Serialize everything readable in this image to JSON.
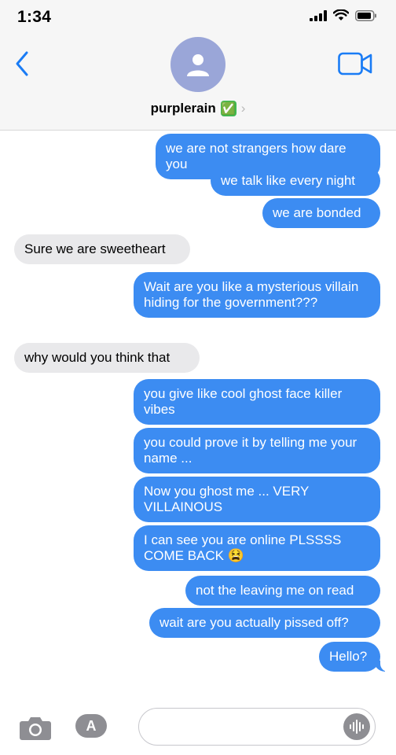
{
  "status": {
    "time": "1:34"
  },
  "contact": {
    "name": "purplerain",
    "badge": "✅"
  },
  "messages": [
    {
      "dir": "out",
      "text": "we are not strangers how dare you"
    },
    {
      "dir": "out",
      "text": "we talk like every night"
    },
    {
      "dir": "out",
      "text": "we are bonded"
    },
    {
      "dir": "in",
      "text": "Sure we are sweetheart"
    },
    {
      "dir": "out",
      "text": "Wait are you like a mysterious villain hiding for the government???"
    },
    {
      "dir": "in",
      "text": "why would you think that"
    },
    {
      "dir": "out",
      "text": "you give like cool ghost face killer vibes"
    },
    {
      "dir": "out",
      "text": "you could prove it by telling me your name ..."
    },
    {
      "dir": "out",
      "text": "Now you ghost me ... VERY VILLAINOUS"
    },
    {
      "dir": "out",
      "text": "I can see you are online PLSSSS COME BACK 😫"
    },
    {
      "dir": "out",
      "text": "not the leaving me on read"
    },
    {
      "dir": "out",
      "text": "wait are you actually pissed off?"
    },
    {
      "dir": "out",
      "text": "Hello?"
    }
  ],
  "composer": {
    "placeholder": ""
  },
  "colors": {
    "outgoing": "#3c8cf2",
    "incoming": "#e9e9eb",
    "accent": "#1a7cf5"
  },
  "icons": [
    "back-chevron-icon",
    "video-camera-icon",
    "camera-icon",
    "app-store-icon",
    "audio-waveform-icon",
    "signal-icon",
    "wifi-icon",
    "battery-icon"
  ]
}
